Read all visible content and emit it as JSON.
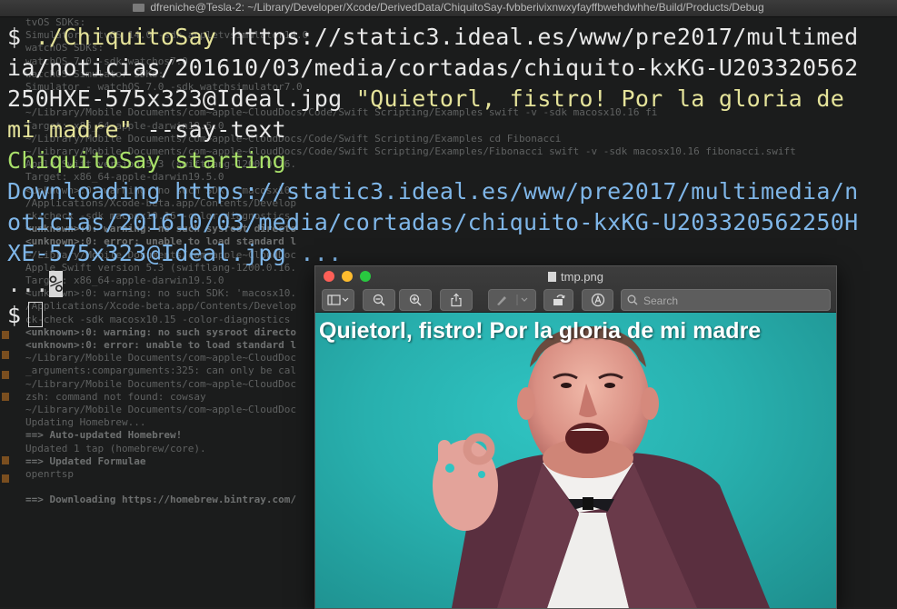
{
  "terminal": {
    "title": "dfreniche@Tesla-2: ~/Library/Developer/Xcode/DerivedData/ChiquitoSay-fvbberivixnwxyfayffbwehdwhhe/Build/Products/Debug",
    "lines": [
      {
        "prompt": "$ ",
        "cmd": "./ChiquitoSay",
        "rest": " https://static3.ideal.es/www/pre2017/multimed"
      },
      {
        "text": "ia/noticias/201610/03/media/cortadas/chiquito-kxKG-U203320562"
      },
      {
        "text_a": "250HXE-575x323@Ideal.jpg ",
        "text_b": "\"Quietorl, fistro! Por la gloria de"
      },
      {
        "text_a": "mi madre\"",
        "text_b": " --say-text"
      },
      {
        "text": "ChiquitoSay starting"
      },
      {
        "text": "Downloading https://static3.ideal.es/www/pre2017/multimedia/n"
      },
      {
        "text": "oticias/201610/03/media/cortadas/chiquito-kxKG-U203320562250H"
      },
      {
        "text": "XE-575x323@Ideal.jpg ..."
      },
      {
        "text": "...",
        "mark": "%"
      },
      {
        "prompt": "$"
      }
    ],
    "background_lines": [
      {
        "t": "tvOS SDKs:",
        "bold": false
      },
      {
        "t": "Simulator - tvOS 14.0        -sdk appletvsimulator14.0",
        "bold": false
      },
      {
        "t": "watchOS SDKs:",
        "bold": false
      },
      {
        "t": "watchOS 7.0                  -sdk watchos7.0",
        "bold": false
      },
      {
        "t": "watchOS Simulator SDKs:",
        "bold": false
      },
      {
        "t": "Simulator - watchOS 7.0      -sdk watchsimulator7.0",
        "bold": false
      },
      {
        "t": "",
        "bold": false
      },
      {
        "t": "~/Library/Mobile Documents/com~apple~CloudDocs/Code/Swift Scripting/Examples    swift -v -sdk macosx10.16  fi",
        "bold": false
      },
      {
        "t": "Target: x86_64-apple-darwin19.5.0",
        "bold": false
      },
      {
        "t": "~/Library/Mobile Documents/com~apple~CloudDocs/Code/Swift Scripting/Examples    cd Fibonacci",
        "bold": false
      },
      {
        "t": "~/Library/Mobile Documents/com~apple~CloudDocs/Code/Swift Scripting/Examples/Fibonacci    swift -v -sdk macosx10.16  fibonacci.swift",
        "bold": false
      },
      {
        "t": "Apple Swift version 5.3 (swiftlang-1200.0.16.",
        "bold": false
      },
      {
        "t": "Target: x86_64-apple-darwin19.5.0",
        "bold": false
      },
      {
        "t": "<unknown>:0: warning: no such SDK: 'macosx10.",
        "bold": false
      },
      {
        "t": "/Applications/Xcode-beta.app/Contents/Develop",
        "bold": false
      },
      {
        "t": "ck-check -sdk macosx10.16 -color-diagnostics",
        "bold": false
      },
      {
        "t": "<unknown>:0: warning: no such sysroot directo",
        "bold": true
      },
      {
        "t": "<unknown>:0: error: unable to load standard l",
        "bold": true
      },
      {
        "t": "~/Library/Mobile Documents/com~apple~CloudDoc",
        "bold": false
      },
      {
        "t": "Apple Swift version 5.3 (swiftlang-1200.0.16.",
        "bold": false
      },
      {
        "t": "Target: x86_64-apple-darwin19.5.0",
        "bold": false
      },
      {
        "t": "<unknown>:0: warning: no such SDK: 'macosx10.",
        "bold": false
      },
      {
        "t": "/Applications/Xcode-beta.app/Contents/Develop",
        "bold": false
      },
      {
        "t": "ck-check -sdk macosx10.15 -color-diagnostics",
        "bold": false
      },
      {
        "t": "<unknown>:0: warning: no such sysroot directo",
        "bold": true
      },
      {
        "t": "<unknown>:0: error: unable to load standard l",
        "bold": true
      },
      {
        "t": "~/Library/Mobile Documents/com~apple~CloudDoc",
        "bold": false
      },
      {
        "t": "_arguments:comparguments:325: can only be cal",
        "bold": false
      },
      {
        "t": "~/Library/Mobile Documents/com~apple~CloudDoc",
        "bold": false
      },
      {
        "t": "zsh: command not found: cowsay",
        "bold": false
      },
      {
        "t": "~/Library/Mobile Documents/com~apple~CloudDoc",
        "bold": false
      },
      {
        "t": "Updating Homebrew...",
        "bold": false
      },
      {
        "t": "==> Auto-updated Homebrew!",
        "bold": true
      },
      {
        "t": "Updated 1 tap (homebrew/core).",
        "bold": false
      },
      {
        "t": "==> Updated Formulae",
        "bold": true
      },
      {
        "t": "openrtsp",
        "bold": false
      },
      {
        "t": "",
        "bold": false
      },
      {
        "t": "==> Downloading https://homebrew.bintray.com/",
        "bold": true
      }
    ]
  },
  "preview": {
    "title": "tmp.png",
    "toolbar": {
      "sidebar": "sidebar-toggle",
      "zoom_out": "zoom-out",
      "zoom_in": "zoom-in",
      "share": "share",
      "markup": "markup-pen",
      "rotate": "rotate",
      "annotate": "annotate"
    },
    "search_placeholder": "Search",
    "caption": "Quietorl, fistro! Por la gloria de mi madre"
  }
}
